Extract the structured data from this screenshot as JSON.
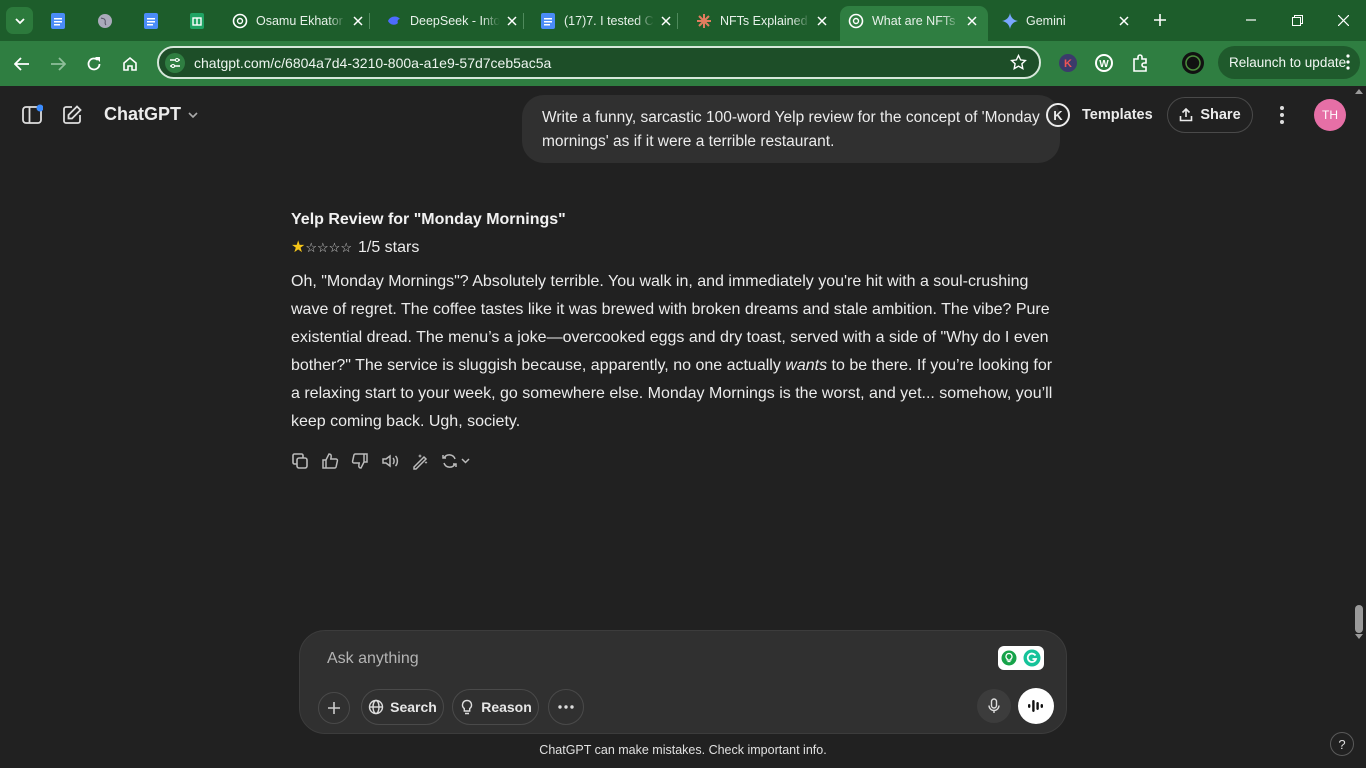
{
  "browser": {
    "tabs": [
      {
        "title": "",
        "icon": "google-docs-icon"
      },
      {
        "title": "",
        "icon": "globe-icon"
      },
      {
        "title": "",
        "icon": "google-docs-icon"
      },
      {
        "title": "",
        "icon": "google-sheets-icon"
      },
      {
        "title": "Osamu Ekhator",
        "icon": "openai-icon"
      },
      {
        "title": "DeepSeek - Into",
        "icon": "deepseek-icon"
      },
      {
        "title": "(17)7. I tested C",
        "icon": "google-docs-icon"
      },
      {
        "title": "NFTs Explained",
        "icon": "claude-icon"
      },
      {
        "title": "What are NFTs",
        "icon": "openai-icon",
        "active": true
      },
      {
        "title": "Gemini",
        "icon": "gemini-icon"
      }
    ],
    "url": "chatgpt.com/c/6804a7d4-3210-800a-a1e9-57d7ceb5ac5a",
    "relaunch_label": "Relaunch to update"
  },
  "header": {
    "brand": "ChatGPT",
    "templates_label": "Templates",
    "k_letter": "K",
    "share_label": "Share",
    "avatar_initials": "TH"
  },
  "conversation": {
    "user_message": "Write a funny, sarcastic 100-word Yelp review for the concept of 'Monday mornings' as if it were a terrible restaurant.",
    "answer_title": "Yelp Review for \"Monday Mornings\"",
    "rating_text": "1/5 stars",
    "rating_value": 1,
    "rating_max": 5,
    "paragraph_part1": "Oh, \"Monday Mornings\"? Absolutely terrible. You walk in, and immediately you're hit with a soul-crushing wave of regret. The coffee tastes like it was brewed with broken dreams and stale ambition. The vibe? Pure existential dread. The menu’s a joke—overcooked eggs and dry toast, served with a side of \"Why do I even bother?\" The service is sluggish because, apparently, no one actually ",
    "paragraph_emphasis": "wants",
    "paragraph_part2": " to be there. If you’re looking for a relaxing start to your week, go somewhere else. Monday Mornings is the worst, and yet... somehow, you’ll keep coming back. Ugh, society."
  },
  "composer": {
    "placeholder": "Ask anything",
    "search_label": "Search",
    "reason_label": "Reason"
  },
  "footer": {
    "disclaimer": "ChatGPT can make mistakes. Check important info.",
    "help": "?"
  },
  "colors": {
    "tab_strip": "#1d5d2b",
    "toolbar": "#2f7e41",
    "page_bg": "#212121",
    "bubble_bg": "#303030",
    "avatar": "#e66fa6",
    "star": "#f5c518"
  }
}
